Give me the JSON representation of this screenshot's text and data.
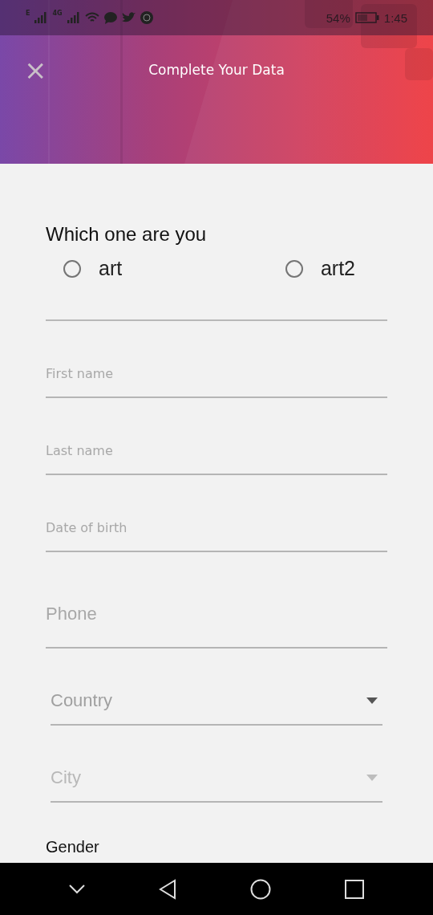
{
  "status_bar": {
    "battery_text": "54%",
    "time": "1:45",
    "network_1": "E",
    "network_2": "4G"
  },
  "header": {
    "title": "Complete Your Data",
    "close": "×"
  },
  "role_question": {
    "label": "Which one are you",
    "options": [
      {
        "label": "art",
        "selected": false
      },
      {
        "label": "art2",
        "selected": false
      }
    ]
  },
  "fields": [
    {
      "kind": "text",
      "placeholder": "First name"
    },
    {
      "kind": "text",
      "placeholder": "Last name"
    },
    {
      "kind": "text",
      "placeholder": "Date of birth"
    },
    {
      "kind": "phone",
      "placeholder": "Phone"
    },
    {
      "kind": "dropdown",
      "placeholder": "Country",
      "disabled": false
    },
    {
      "kind": "dropdown",
      "placeholder": "City",
      "disabled": true
    }
  ],
  "gender": {
    "label": "Gender"
  }
}
